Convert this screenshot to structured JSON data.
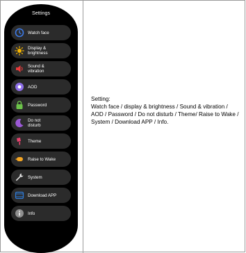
{
  "watch": {
    "title": "Settings",
    "menu": [
      {
        "label": "Watch face",
        "icon": "watch-face-icon"
      },
      {
        "label": "Display &\nbrightness",
        "icon": "sun-icon"
      },
      {
        "label": "Sound &\nvibration",
        "icon": "speaker-icon"
      },
      {
        "label": "AOD",
        "icon": "aod-icon"
      },
      {
        "label": "Password",
        "icon": "lock-icon"
      },
      {
        "label": "Do not\ndisturb",
        "icon": "moon-icon"
      },
      {
        "label": "Theme",
        "icon": "theme-icon"
      },
      {
        "label": "Raise to Wake",
        "icon": "raise-hand-icon"
      },
      {
        "label": "System",
        "icon": "wrench-icon"
      },
      {
        "label": "Download APP",
        "icon": "download-icon"
      },
      {
        "label": "Info",
        "icon": "info-icon"
      }
    ]
  },
  "caption": {
    "heading": "Setting:",
    "body": "Watch face / display & brightness / Sound & vibration / AOD / Password / Do not disturb / Theme/  Raise to Wake / System / Download APP / Info."
  },
  "colors": {
    "watch_bg": "#000000",
    "item_bg": "#2b2b2b",
    "watch_face": "#3d7be8",
    "sun": "#f7b500",
    "speaker": "#e83b3b",
    "aod": "#8e6fe8",
    "lock": "#6cc24a",
    "moon": "#9b59d6",
    "theme": "#e8436f",
    "raise": "#f5a623",
    "wrench": "#e6e6e6",
    "download": "#2e7bd8",
    "info": "#8f8f8f"
  }
}
